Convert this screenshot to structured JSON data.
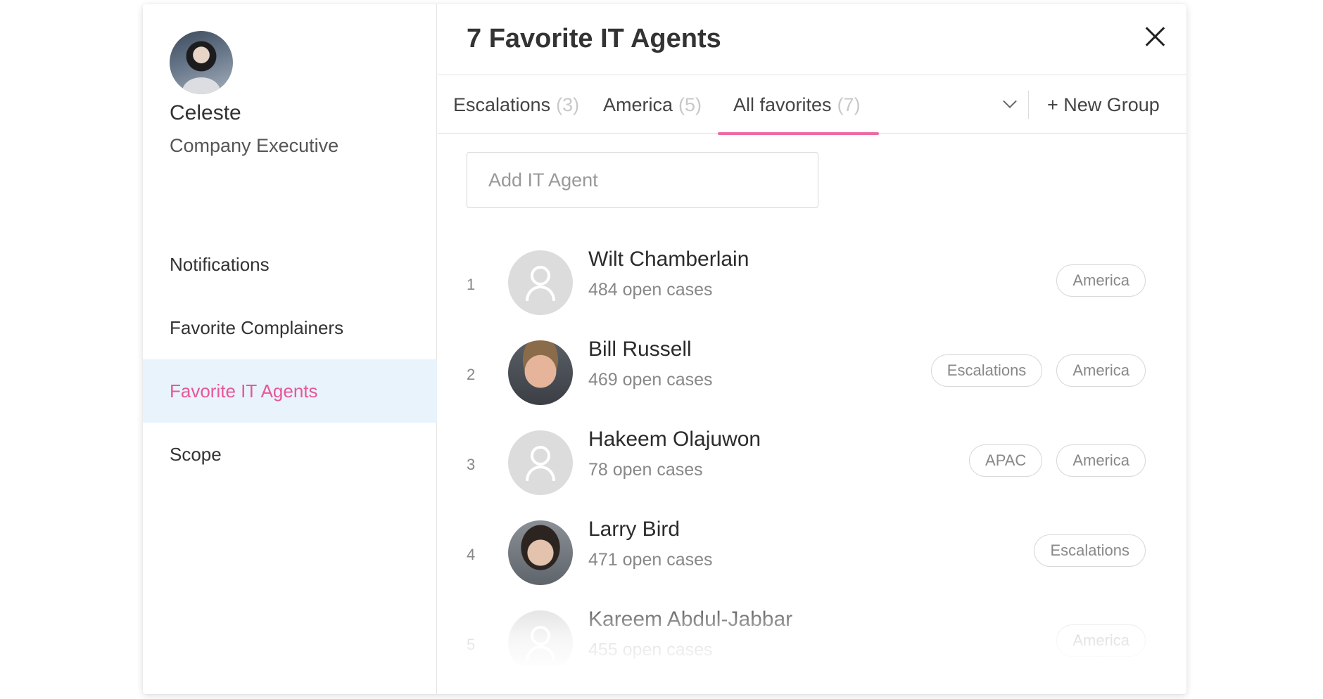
{
  "profile": {
    "name": "Celeste",
    "role": "Company Executive"
  },
  "nav": {
    "items": [
      {
        "label": "Notifications"
      },
      {
        "label": "Favorite Complainers"
      },
      {
        "label": "Favorite IT Agents"
      },
      {
        "label": "Scope"
      }
    ],
    "active_index": 2
  },
  "main": {
    "title": "7 Favorite IT Agents",
    "tabs": [
      {
        "label": "Escalations",
        "count": "(3)"
      },
      {
        "label": "America",
        "count": "(5)"
      },
      {
        "label": "All favorites",
        "count": "(7)"
      }
    ],
    "active_tab_index": 2,
    "new_group_label": "+ New Group",
    "add_placeholder": "Add IT Agent"
  },
  "agents": [
    {
      "rank": "1",
      "name": "Wilt Chamberlain",
      "cases": "484 open cases",
      "tags": [
        "America"
      ],
      "avatar": "placeholder-icon"
    },
    {
      "rank": "2",
      "name": "Bill Russell",
      "cases": "469 open cases",
      "tags": [
        "Escalations",
        "America"
      ],
      "avatar": "photo"
    },
    {
      "rank": "3",
      "name": "Hakeem Olajuwon",
      "cases": "78 open cases",
      "tags": [
        "APAC",
        "America"
      ],
      "avatar": "placeholder-icon"
    },
    {
      "rank": "4",
      "name": "Larry Bird",
      "cases": "471 open cases",
      "tags": [
        "Escalations"
      ],
      "avatar": "photo"
    },
    {
      "rank": "5",
      "name": "Kareem Abdul-Jabbar",
      "cases": "455 open cases",
      "tags": [
        "America"
      ],
      "avatar": "placeholder-icon"
    }
  ],
  "colors": {
    "accent": "#ee6aa6",
    "active_nav_bg": "#e8f3fb"
  }
}
